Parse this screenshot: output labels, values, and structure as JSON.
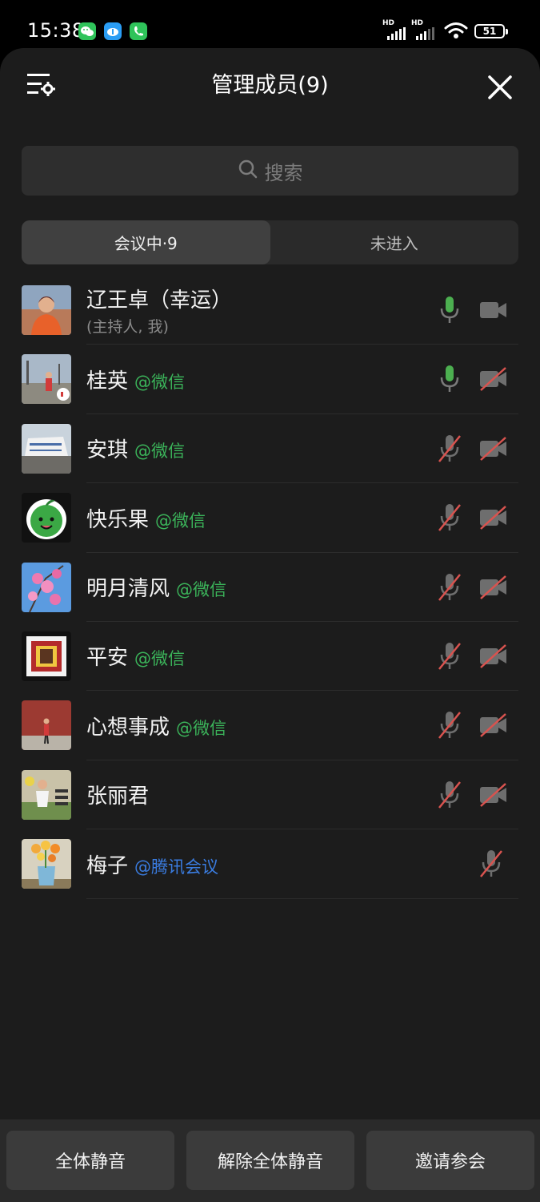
{
  "status_bar": {
    "time": "15:38",
    "apps": [
      "wechat-icon",
      "cloud-app-icon",
      "phone-app-icon"
    ],
    "signal_labels": [
      "HD",
      "HD"
    ],
    "battery": "51"
  },
  "header": {
    "title": "管理成员(9)",
    "left_icon": "list-settings-icon",
    "right_icon": "close-icon"
  },
  "search": {
    "placeholder": "搜索"
  },
  "tabs": [
    {
      "label": "会议中·9",
      "active": true
    },
    {
      "label": "未进入",
      "active": false
    }
  ],
  "members": [
    {
      "name": "辽王卓（幸运）",
      "subtitle": "(主持人, 我)",
      "source": "",
      "mic": "on",
      "cam": "on"
    },
    {
      "name": "桂英",
      "source": "@微信",
      "source_type": "wechat",
      "mic": "on",
      "cam": "off"
    },
    {
      "name": "安琪",
      "source": "@微信",
      "source_type": "wechat",
      "mic": "off",
      "cam": "off"
    },
    {
      "name": "快乐果",
      "source": "@微信",
      "source_type": "wechat",
      "mic": "off",
      "cam": "off"
    },
    {
      "name": "明月清风",
      "source": "@微信",
      "source_type": "wechat",
      "mic": "off",
      "cam": "off"
    },
    {
      "name": "平安",
      "source": "@微信",
      "source_type": "wechat",
      "mic": "off",
      "cam": "off"
    },
    {
      "name": "心想事成",
      "source": "@微信",
      "source_type": "wechat",
      "mic": "off",
      "cam": "off"
    },
    {
      "name": "张丽君",
      "source": "",
      "mic": "off",
      "cam": "off"
    },
    {
      "name": "梅子",
      "source": "@腾讯会议",
      "source_type": "tencent",
      "mic": "off",
      "cam": "none"
    }
  ],
  "bottom_buttons": {
    "mute_all": "全体静音",
    "unmute_all": "解除全体静音",
    "invite": "邀请参会"
  },
  "colors": {
    "mic_on": "#4caf50",
    "muted_slash": "#d9534f",
    "wechat_text": "#3bb45a",
    "tencent_text": "#3a7ce0"
  }
}
